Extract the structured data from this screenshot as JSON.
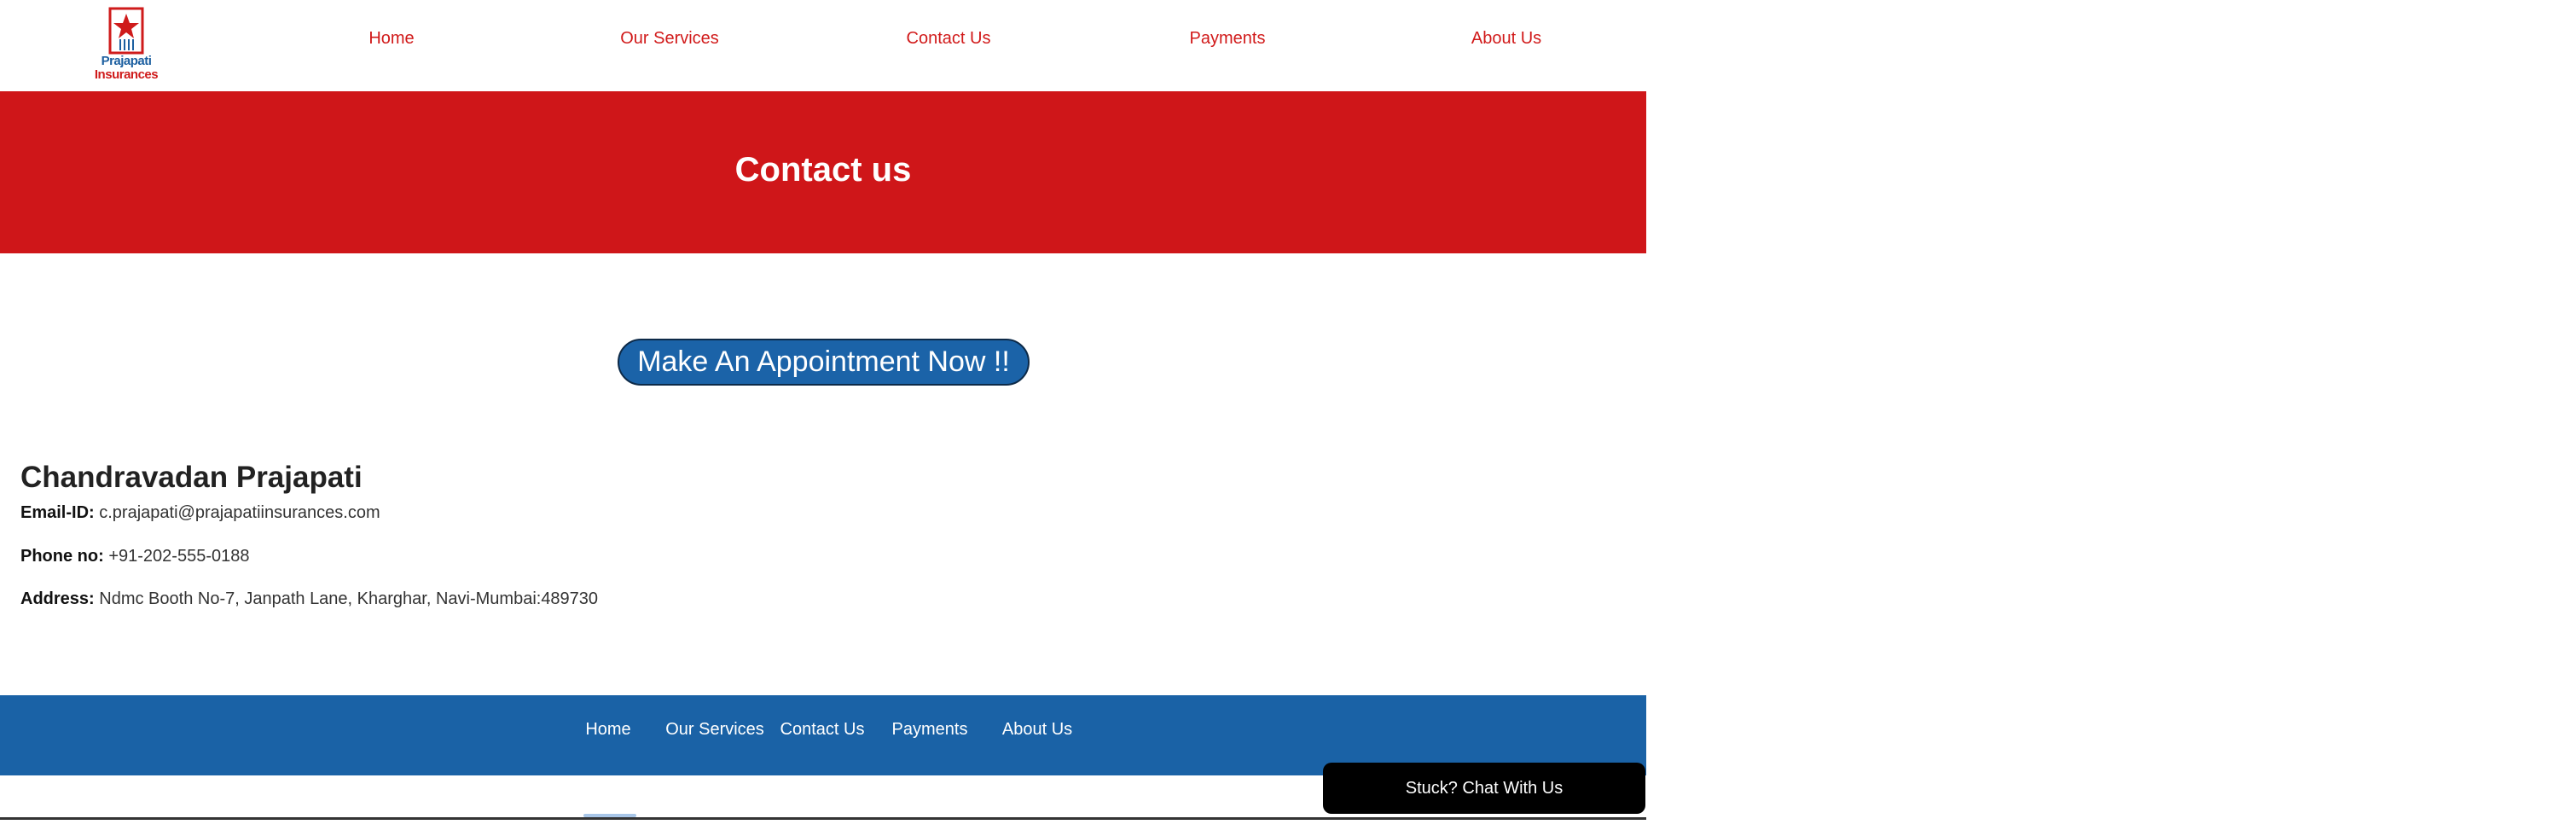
{
  "brand": {
    "logo_line1": "Prajapati",
    "logo_line2": "Insurances",
    "primary_red": "#cf1619",
    "primary_blue": "#1a62a6",
    "logo_icon": "star-shield-icon"
  },
  "nav": {
    "items": [
      {
        "label": "Home"
      },
      {
        "label": "Our Services"
      },
      {
        "label": "Contact Us"
      },
      {
        "label": "Payments"
      },
      {
        "label": "About Us"
      }
    ]
  },
  "banner": {
    "title": "Contact us"
  },
  "appointment": {
    "label": "Make An Appointment Now !!"
  },
  "contact": {
    "name": "Chandravadan Prajapati",
    "email_label": "Email-ID:",
    "email": "c.prajapati@prajapatiinsurances.com",
    "phone_label": "Phone no:",
    "phone": "+91-202-555-0188",
    "address_label": "Address:",
    "address": "Ndmc Booth No-7, Janpath Lane, Kharghar, Navi-Mumbai:489730"
  },
  "footer": {
    "items": [
      {
        "label": "Home"
      },
      {
        "label": "Our Services"
      },
      {
        "label": "Contact Us"
      },
      {
        "label": "Payments"
      },
      {
        "label": "About Us"
      }
    ]
  },
  "chat": {
    "label": "Stuck? Chat With Us"
  }
}
